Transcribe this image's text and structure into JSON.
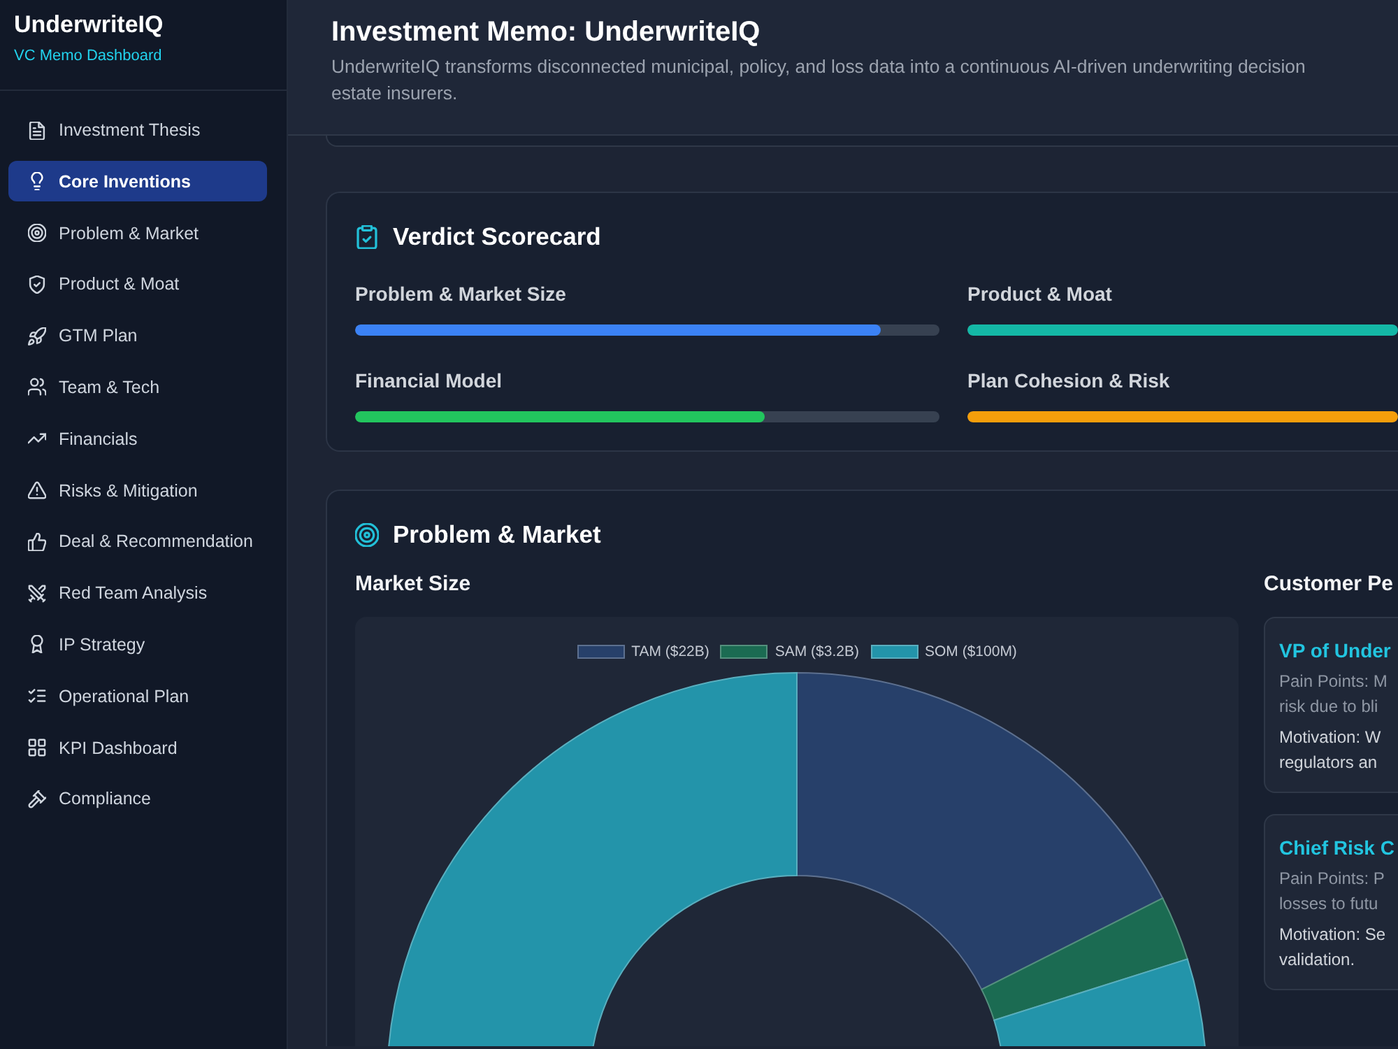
{
  "sidebar": {
    "brand": "UnderwriteIQ",
    "subtitle": "VC Memo Dashboard",
    "items": [
      {
        "label": "Investment Thesis",
        "selected": false
      },
      {
        "label": "Core Inventions",
        "selected": true
      },
      {
        "label": "Problem & Market",
        "selected": false
      },
      {
        "label": "Product & Moat",
        "selected": false
      },
      {
        "label": "GTM Plan",
        "selected": false
      },
      {
        "label": "Team & Tech",
        "selected": false
      },
      {
        "label": "Financials",
        "selected": false
      },
      {
        "label": "Risks & Mitigation",
        "selected": false
      },
      {
        "label": "Deal & Recommendation",
        "selected": false
      },
      {
        "label": "Red Team Analysis",
        "selected": false
      },
      {
        "label": "IP Strategy",
        "selected": false
      },
      {
        "label": "Operational Plan",
        "selected": false
      },
      {
        "label": "KPI Dashboard",
        "selected": false
      },
      {
        "label": "Compliance",
        "selected": false
      }
    ]
  },
  "header": {
    "title": "Investment Memo: UnderwriteIQ",
    "description_lines": [
      "UnderwriteIQ transforms disconnected municipal, policy, and loss data into a continuous AI-driven underwriting decision",
      "estate insurers."
    ]
  },
  "scorecard": {
    "title": "Verdict Scorecard",
    "items": [
      {
        "label": "Problem & Market Size",
        "level": 0.9,
        "color": "#3b82f6"
      },
      {
        "label": "Product & Moat",
        "level": 1,
        "color": "#14b8a6"
      },
      {
        "label": "Financial Model",
        "level": 0.7,
        "color": "#22c55e"
      },
      {
        "label": "Plan Cohesion & Risk",
        "level": 1,
        "color": "#f59e0b"
      }
    ]
  },
  "problem_market": {
    "title": "Problem & Market",
    "market_size": {
      "title": "Market Size",
      "chart_data": {
        "type": "donut",
        "categories": [
          "TAM ($22B)",
          "SAM ($3.2B)",
          "SOM ($100M)"
        ],
        "values": [
          22,
          3.2,
          100
        ],
        "colors": [
          "#27406a",
          "#1b6b52",
          "#2394aa"
        ],
        "legend": "top"
      }
    },
    "personas": {
      "title": "Customer Pe",
      "cards": [
        {
          "name": "VP of Under",
          "pain_points_lines": [
            "Pain Points: M",
            "risk due to bli"
          ],
          "motivation_lines": [
            "Motivation: W",
            "regulators an"
          ]
        },
        {
          "name": "Chief Risk C",
          "pain_points_lines": [
            "Pain Points: P",
            "losses to futu"
          ],
          "motivation_lines": [
            "Motivation: Se",
            "validation."
          ]
        }
      ]
    }
  }
}
